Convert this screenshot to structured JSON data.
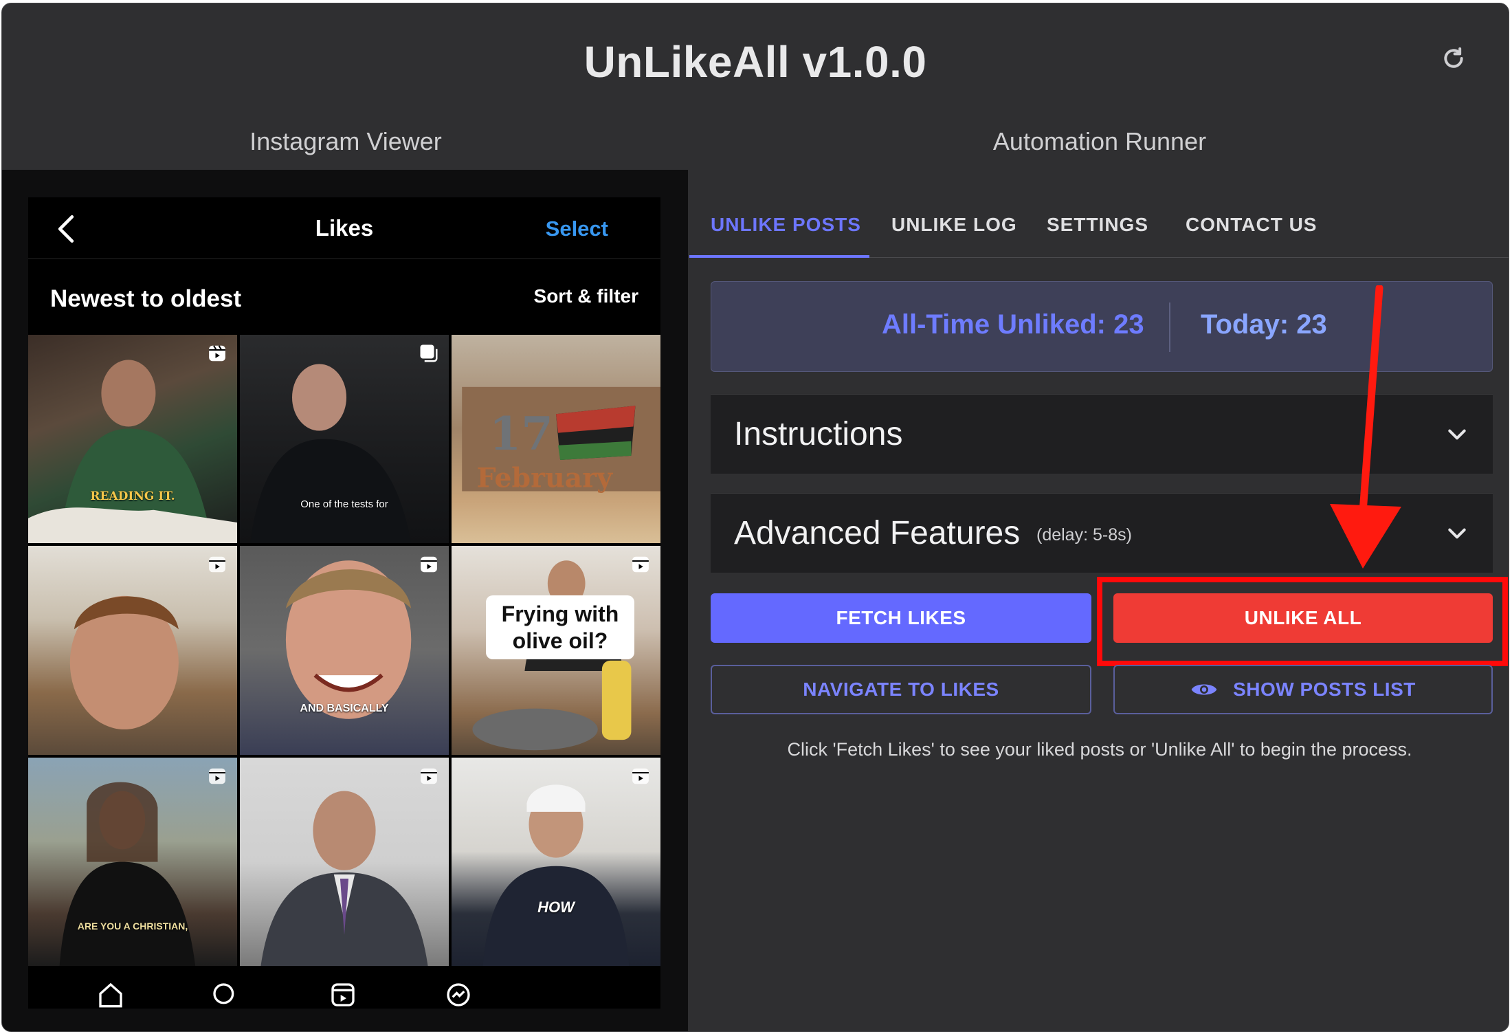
{
  "app": {
    "title": "UnLikeAll v1.0.0"
  },
  "sections": {
    "left": "Instagram Viewer",
    "right": "Automation Runner"
  },
  "instagram": {
    "title": "Likes",
    "select_label": "Select",
    "sort_heading": "Newest to oldest",
    "sort_filter_label": "Sort & filter",
    "tiles": [
      {
        "caption": "READING IT.",
        "icon": "reel-icon"
      },
      {
        "caption": "One of the tests for",
        "icon": "carousel-icon"
      },
      {
        "caption": "",
        "icon": ""
      },
      {
        "caption": "",
        "icon": "reel-icon"
      },
      {
        "caption": "AND BASICALLY",
        "icon": "reel-icon"
      },
      {
        "caption": "Frying with olive oil?",
        "icon": "reel-icon"
      },
      {
        "caption": "ARE YOU A CHRISTIAN,",
        "icon": "reel-icon"
      },
      {
        "caption": "",
        "icon": "reel-icon"
      },
      {
        "caption": "HOW",
        "icon": "reel-icon"
      }
    ],
    "nav_icons": [
      "home-icon",
      "search-icon",
      "reels-icon",
      "messenger-icon"
    ]
  },
  "tabs": [
    {
      "label": "UNLIKE POSTS",
      "active": true
    },
    {
      "label": "UNLIKE LOG",
      "active": false
    },
    {
      "label": "SETTINGS",
      "active": false
    },
    {
      "label": "CONTACT US",
      "active": false
    }
  ],
  "stats": {
    "all_time": "All-Time Unliked: 23",
    "today": "Today: 23"
  },
  "accordions": {
    "instructions": {
      "title": "Instructions"
    },
    "advanced": {
      "title": "Advanced Features",
      "subtitle": "(delay: 5-8s)"
    }
  },
  "buttons": {
    "fetch": "FETCH LIKES",
    "unlike_all": "UNLIKE ALL",
    "navigate": "NAVIGATE TO LIKES",
    "show_posts": "SHOW POSTS LIST"
  },
  "hint": "Click 'Fetch Likes' to see your liked posts or 'Unlike All' to begin the process.",
  "colors": {
    "accent": "#6469ff",
    "danger": "#ef3b35",
    "annotation": "#ff0a0a",
    "background": "#2f2f31"
  }
}
